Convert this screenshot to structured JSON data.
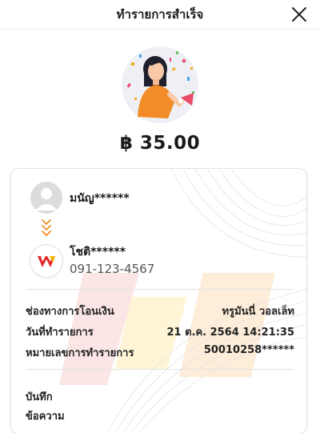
{
  "header": {
    "title": "ทำรายการสำเร็จ"
  },
  "amount": "฿ 35.00",
  "sender": {
    "name": "มนัญ******"
  },
  "receiver": {
    "name": "โชติ******",
    "phone": "091-123-4567"
  },
  "details": [
    {
      "label": "ช่องทางการโอนเงิน",
      "value": "ทรูมันนี่ วอลเล็ท"
    },
    {
      "label": "วันที่ทำรายการ",
      "value": "21 ต.ค. 2564 14:21:35"
    },
    {
      "label": "หมายเลขการทำรายการ",
      "value": "50010258******"
    }
  ],
  "note_label": "บันทึก",
  "message_label": "ข้อความ",
  "colors": {
    "accent_orange": "#f28c28",
    "wallet_red": "#e0262a",
    "wallet_yellow": "#f5b400"
  }
}
